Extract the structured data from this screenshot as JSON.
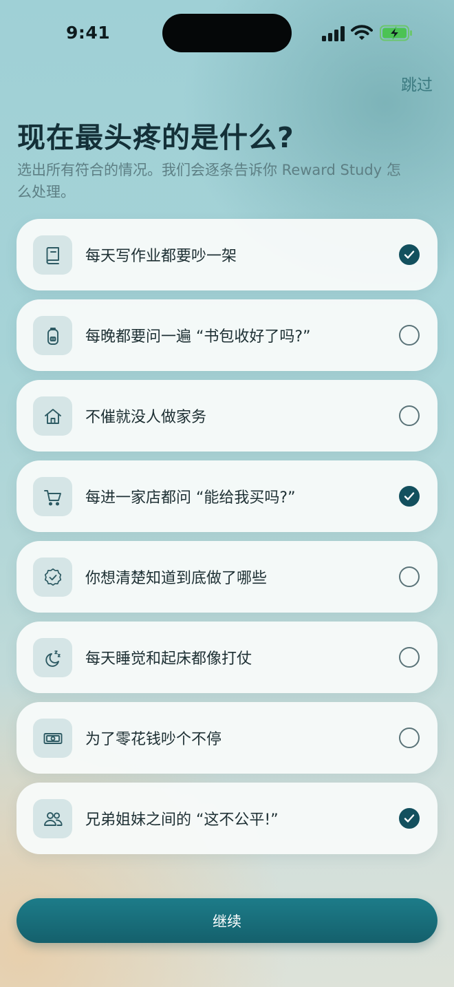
{
  "status_bar": {
    "time": "9:41"
  },
  "header": {
    "skip_label": "跳过",
    "title": "现在最头疼的是什么?",
    "subtitle": "选出所有符合的情况。我们会逐条告诉你 Reward Study 怎么处理。"
  },
  "options": [
    {
      "label": "每天写作业都要吵一架",
      "icon": "book-icon",
      "checked": true
    },
    {
      "label": "每晚都要问一遍 “书包收好了吗?”",
      "icon": "backpack-icon",
      "checked": false
    },
    {
      "label": "不催就没人做家务",
      "icon": "home-icon",
      "checked": false
    },
    {
      "label": "每进一家店都问 “能给我买吗?”",
      "icon": "cart-icon",
      "checked": true
    },
    {
      "label": "你想清楚知道到底做了哪些",
      "icon": "verified-badge-icon",
      "checked": false
    },
    {
      "label": "每天睡觉和起床都像打仗",
      "icon": "moon-zzz-icon",
      "checked": false
    },
    {
      "label": "为了零花钱吵个不停",
      "icon": "money-icon",
      "checked": false
    },
    {
      "label": "兄弟姐妹之间的 “这不公平!”",
      "icon": "people-icon",
      "checked": true
    }
  ],
  "footer": {
    "continue_label": "继续"
  },
  "colors": {
    "accent": "#13505e",
    "button": "#1a6f7b",
    "skip": "#3b7a80"
  }
}
